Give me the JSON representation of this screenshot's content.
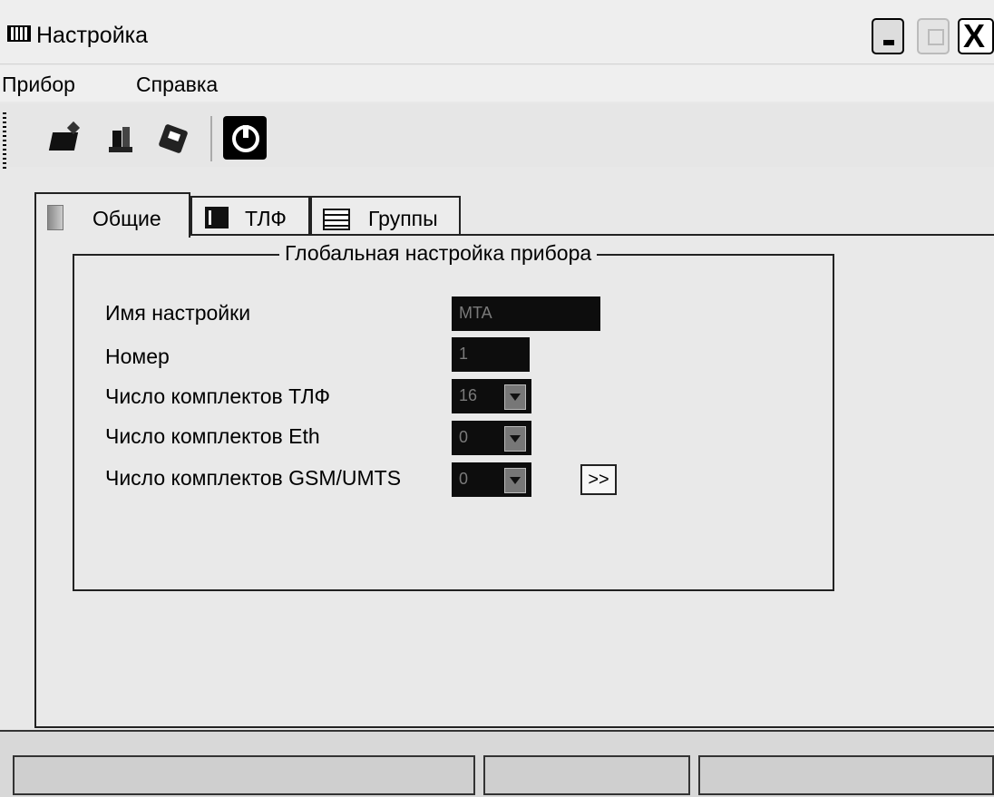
{
  "window": {
    "title": "Настройка",
    "controls": [
      "minimize",
      "maximize",
      "close"
    ],
    "close_glyph": "X"
  },
  "menu": {
    "items": [
      "Прибор",
      "Справка"
    ]
  },
  "toolbar": {
    "icons": [
      "open-folder-icon",
      "save-icon",
      "disk-icon",
      "power-icon"
    ]
  },
  "tabs": [
    {
      "label": "Общие",
      "icon": "general-tab-icon",
      "active": true
    },
    {
      "label": "ТЛФ",
      "icon": "tlf-tab-icon",
      "active": false
    },
    {
      "label": "Группы",
      "icon": "groups-tab-icon",
      "active": false
    }
  ],
  "groupbox": {
    "title": "Глобальная настройка прибора",
    "fields": [
      {
        "label": "Имя настройки",
        "value": "MTA"
      },
      {
        "label": "Номер",
        "value": "1"
      },
      {
        "label": "Число комплектов ТЛФ",
        "value": "16"
      },
      {
        "label": "Число комплектов Eth",
        "value": "0"
      },
      {
        "label": "Число комплектов GSM/UMTS",
        "value": "0"
      }
    ],
    "more_button": ">>"
  },
  "statusbar": {
    "panels": [
      "",
      "",
      ""
    ]
  }
}
